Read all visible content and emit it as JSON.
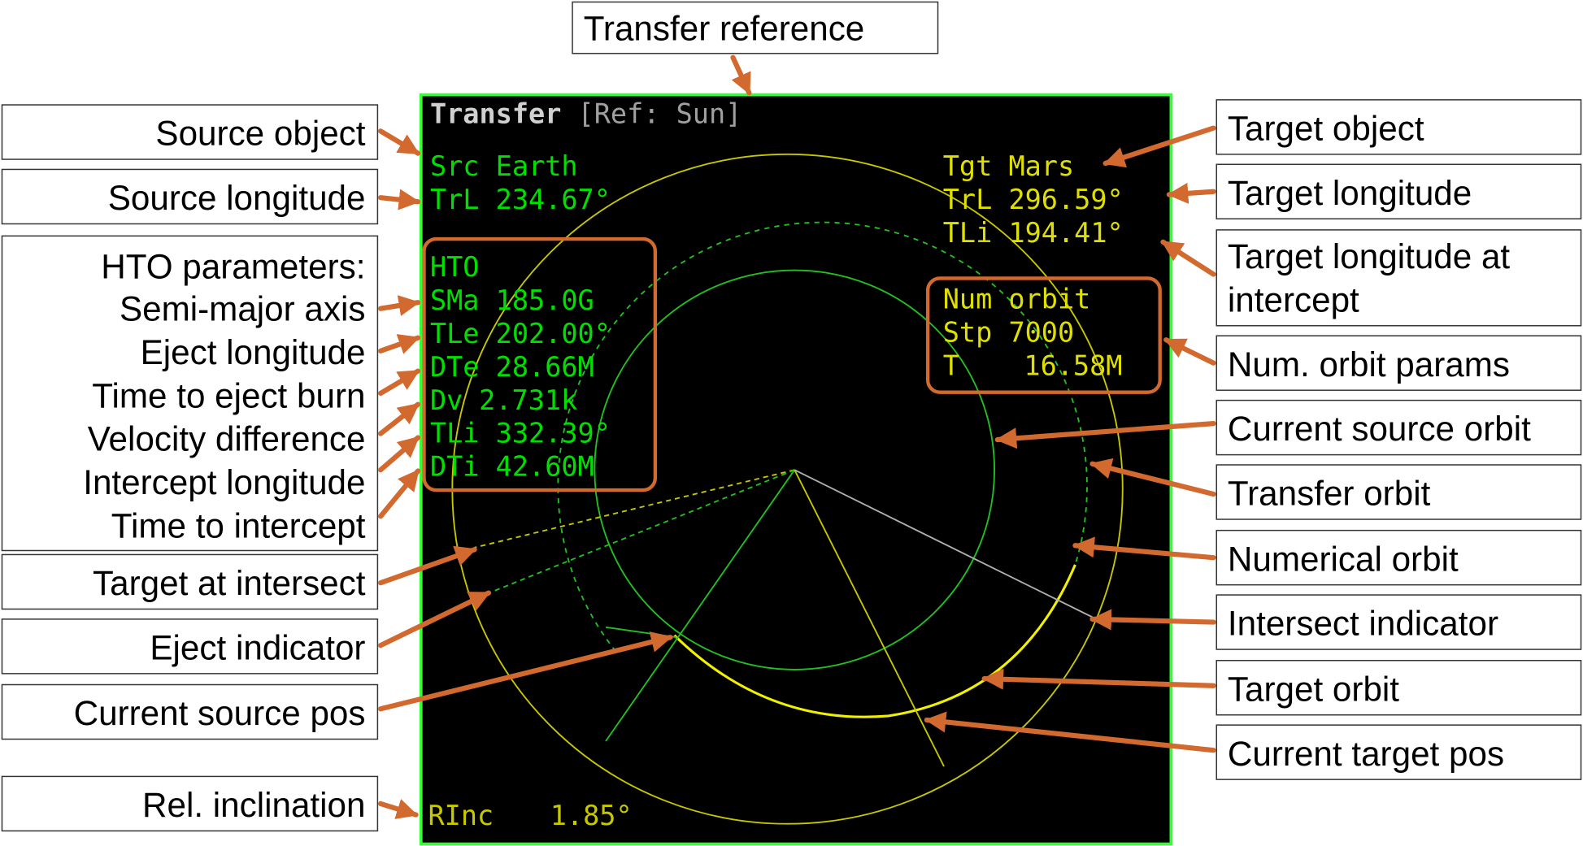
{
  "title_box": "Transfer reference",
  "mfd": {
    "title": "Transfer",
    "ref": "[Ref: Sun]",
    "src": {
      "label": "Src",
      "value": "Earth"
    },
    "src_lon": {
      "label": "TrL",
      "value": "234.67°"
    },
    "tgt": {
      "label": "Tgt",
      "value": "Mars"
    },
    "tgt_lon": {
      "label": "TrL",
      "value": "296.59°"
    },
    "tgt_lon_int": {
      "label": "TLi",
      "value": "194.41°"
    },
    "hto_header": "HTO",
    "hto": [
      {
        "label": "SMa",
        "value": "185.0G"
      },
      {
        "label": "TLe",
        "value": "202.00°"
      },
      {
        "label": "DTe",
        "value": "28.66M"
      },
      {
        "label": "Dv",
        "value": "2.731k"
      },
      {
        "label": "TLi",
        "value": "332.39°"
      },
      {
        "label": "DTi",
        "value": "42.60M"
      }
    ],
    "num_header": "Num orbit",
    "num": [
      {
        "label": "Stp",
        "value": "7000"
      },
      {
        "label": "T",
        "value": "16.58M"
      }
    ],
    "rinc": {
      "label": "RInc",
      "value": "1.85°"
    }
  },
  "left_callouts": {
    "source_object": "Source object",
    "source_longitude": "Source longitude",
    "hto_params": [
      "HTO parameters:",
      "Semi-major axis",
      "Eject longitude",
      "Time to eject burn",
      "Velocity difference",
      "Intercept longitude",
      "Time to intercept"
    ],
    "target_at_intersect": "Target at intersect",
    "eject_indicator": "Eject indicator",
    "current_source_pos": "Current source pos",
    "rel_inclination": "Rel. inclination"
  },
  "right_callouts": {
    "target_object": "Target object",
    "target_longitude": "Target longitude",
    "target_longitude_intercept": [
      "Target longitude at",
      "intercept"
    ],
    "num_orbit_params": "Num. orbit params",
    "current_source_orbit": "Current source orbit",
    "transfer_orbit": "Transfer orbit",
    "numerical_orbit": "Numerical orbit",
    "intersect_indicator": "Intersect indicator",
    "target_orbit": "Target orbit",
    "current_target_pos": "Current target pos"
  },
  "colors": {
    "arrow": "#d2692e",
    "mfd_green": "#00e000",
    "mfd_yellow": "#e0e000",
    "mfd_gray": "#a0a0a0",
    "screen_bg": "#000000",
    "screen_border": "#33ff33"
  }
}
